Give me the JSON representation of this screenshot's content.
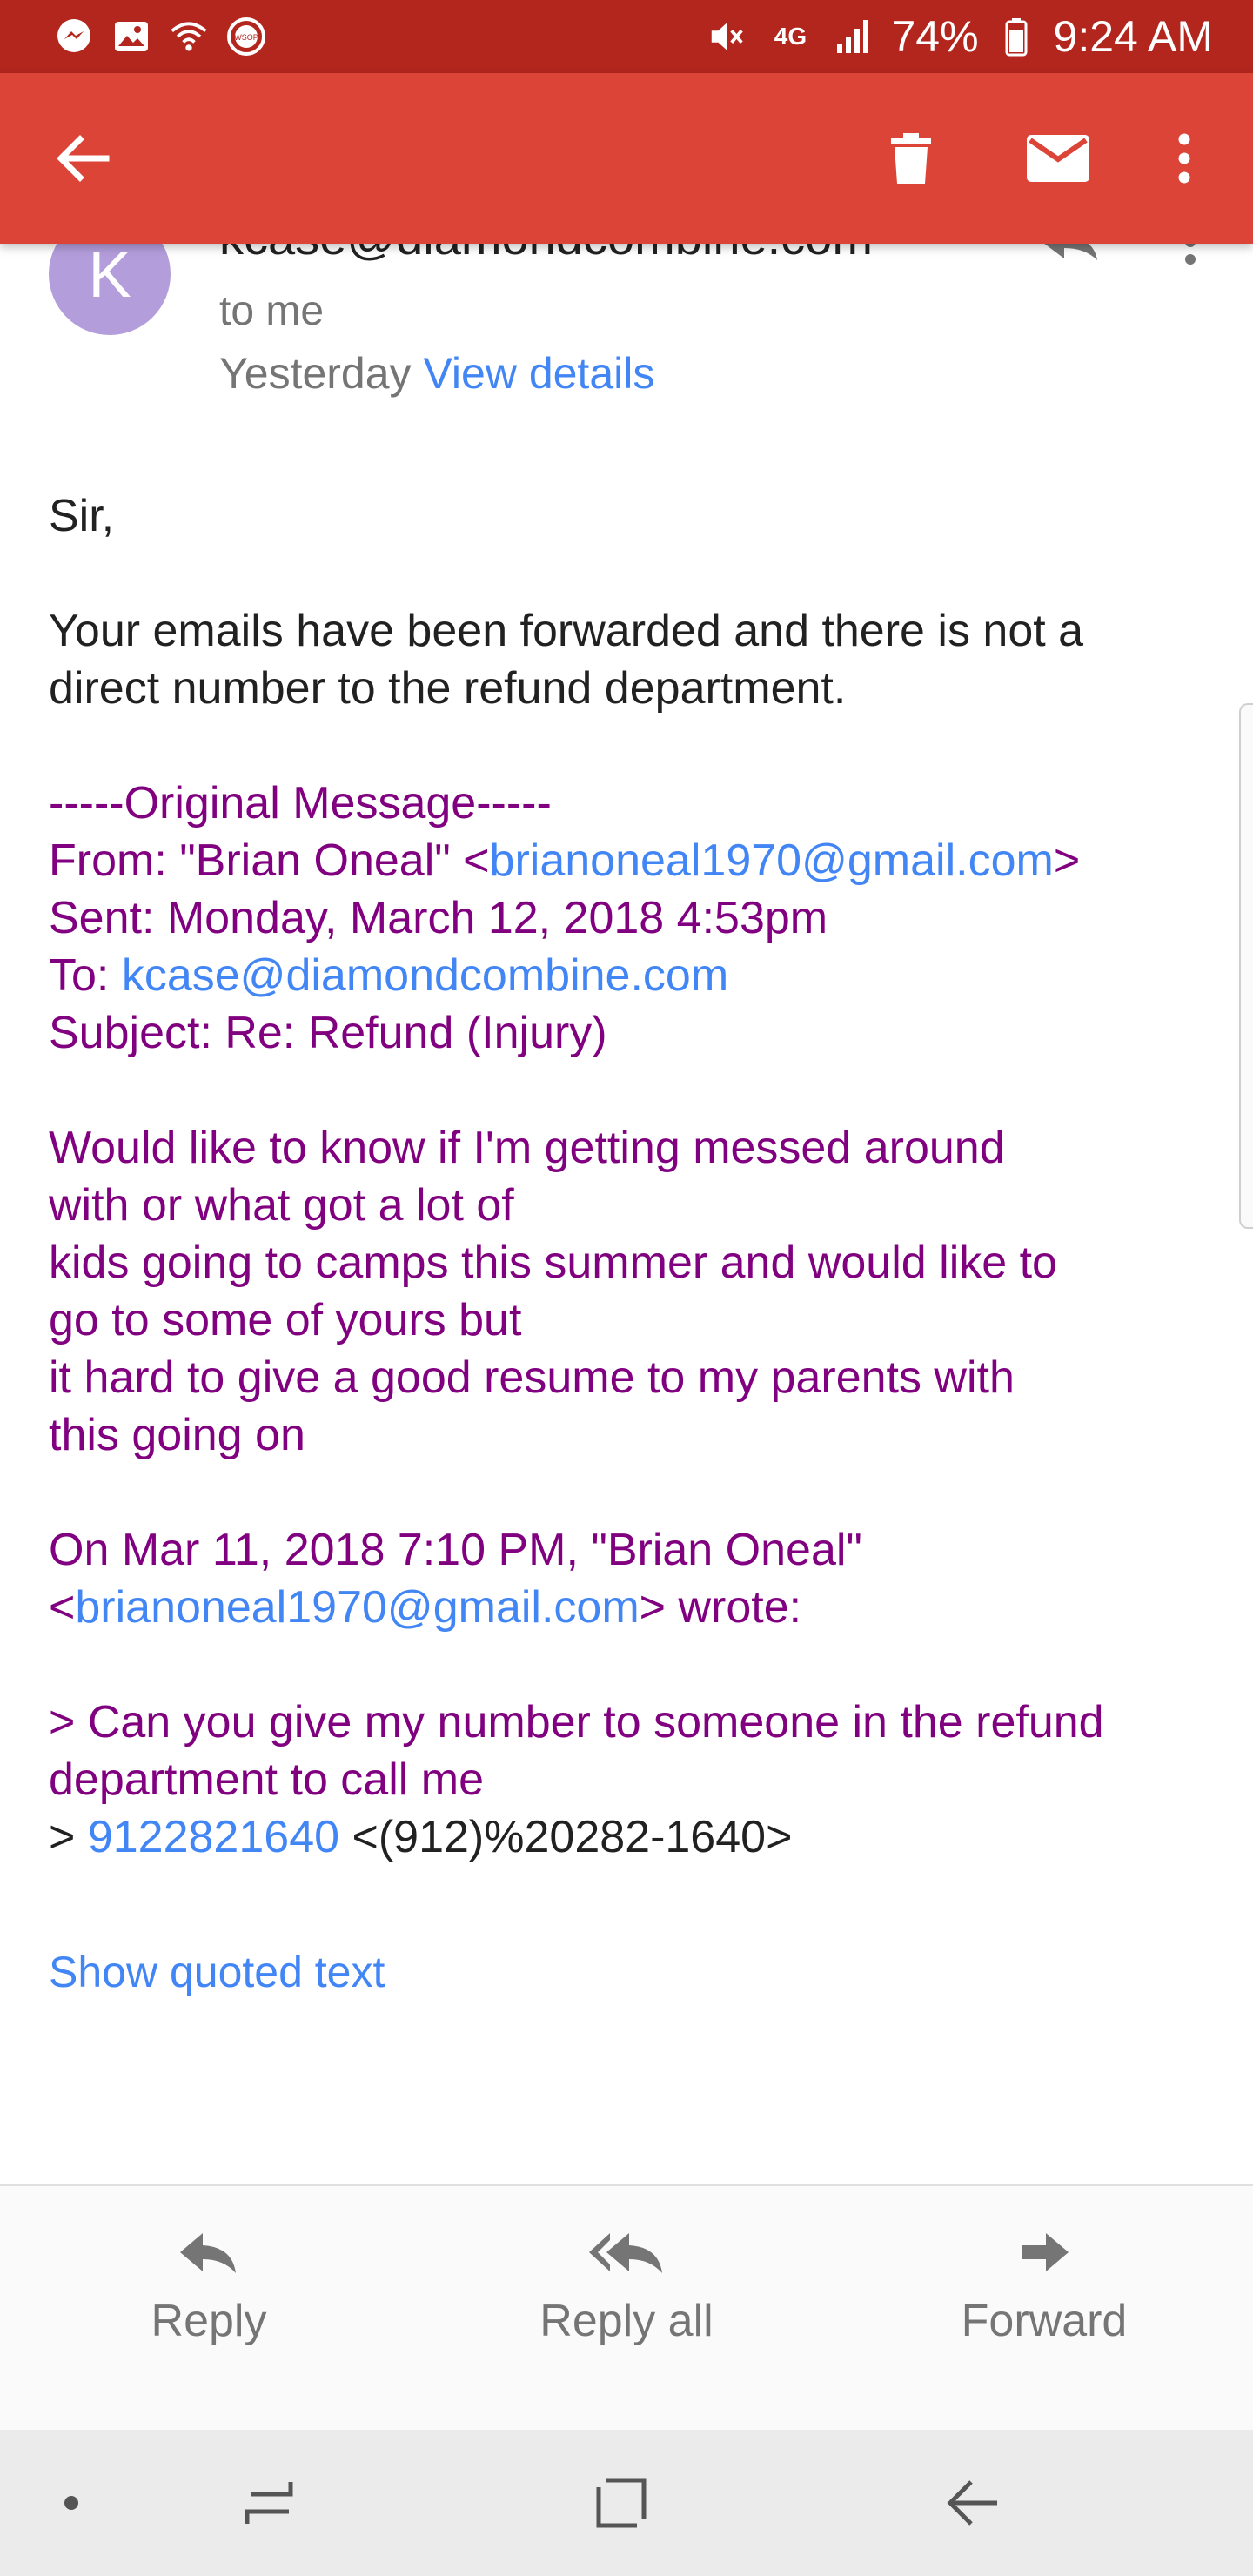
{
  "status_bar": {
    "battery": "74%",
    "time": "9:24 AM",
    "network": "4G",
    "left_icons": [
      "messenger-icon",
      "image-icon",
      "wifi-icon",
      "wsop-icon"
    ],
    "right_icons": [
      "mute-icon",
      "4g-icon",
      "signal-icon",
      "battery-icon"
    ],
    "wsop_label": "WSOP"
  },
  "app_bar": {
    "color": "#db4437",
    "icons": [
      "back-arrow-icon",
      "trash-icon",
      "mail-icon",
      "more-vert-icon"
    ]
  },
  "header": {
    "avatar_letter": "K",
    "avatar_color": "#b39ddb",
    "sender": "kcase@diamondcombine.com",
    "to": "to me",
    "date": "Yesterday",
    "view_details": "View details"
  },
  "body": {
    "greeting": "Sir,",
    "line1": "Your emails have been forwarded and there is not a",
    "line2": "direct number to the refund department.",
    "original_message": "-----Original Message-----",
    "from_label": "From: \"Brian Oneal\" <",
    "from_email": "brianoneal1970@gmail.com",
    "from_close": ">",
    "sent": "Sent: Monday, March 12, 2018 4:53pm",
    "to_label": "To: ",
    "to_email": "kcase@diamondcombine.com",
    "subject": "Subject: Re: Refund (Injury)",
    "quote_lines": [
      "Would like to know if I'm getting  messed around",
      "with or what got a lot of",
      "kids going to camps this summer and would like to",
      "go to some of yours but",
      "it hard to give a good resume to my parents with",
      "this going on"
    ],
    "on_date": "On Mar 11, 2018 7:10 PM, \"Brian Oneal\"",
    "wrote_open": "<",
    "wrote_email": "brianoneal1970@gmail.com",
    "wrote_close": "> wrote:",
    "q1": "> Can you give my number to someone in the refund",
    "q2": "department to call me",
    "q3_prefix": "> ",
    "phone": "9122821640",
    "phone_suffix": " <(912)%20282-1640>",
    "show_quoted": "Show quoted text"
  },
  "actions": [
    {
      "label": "Reply",
      "icon": "reply-icon"
    },
    {
      "label": "Reply all",
      "icon": "reply-all-icon"
    },
    {
      "label": "Forward",
      "icon": "forward-icon"
    }
  ],
  "nav_bar": {
    "icons": [
      "nav-dot-icon",
      "recents-icon",
      "home-icon",
      "back-icon"
    ]
  },
  "colors": {
    "status_bar": "#b3261e",
    "link": "#4285f4",
    "quoted_text": "#800080"
  }
}
